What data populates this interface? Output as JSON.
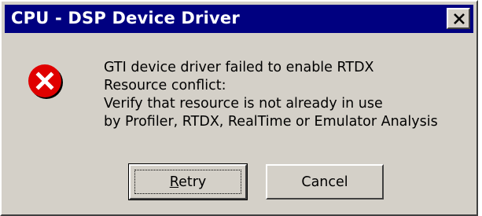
{
  "window": {
    "title": "CPU - DSP Device Driver",
    "colors": {
      "titlebar": "#000080",
      "face": "#d4d0c8",
      "error_red": "#e00000"
    }
  },
  "message": {
    "lines": [
      "GTI device driver failed to enable RTDX",
      "Resource conflict:",
      "Verify that resource is not already in use",
      "by Profiler, RTDX, RealTime or Emulator Analysis"
    ]
  },
  "icons": {
    "close": "close-icon",
    "error": "error-icon"
  },
  "buttons": {
    "retry": {
      "mnemonic": "R",
      "rest": "etry"
    },
    "cancel": {
      "label": "Cancel"
    }
  }
}
